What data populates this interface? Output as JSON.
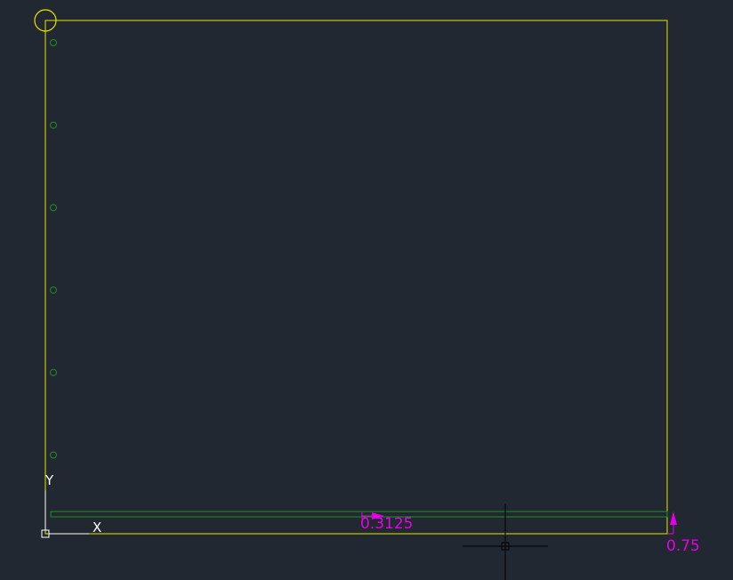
{
  "viewport": {
    "background": "#222831"
  },
  "colors": {
    "border": "#e6e600",
    "holes": "#1f8f1f",
    "strip": "#1f8f1f",
    "dimension": "#e600e6",
    "ucs": "#ffffff",
    "crosshair": "#000000"
  },
  "dimensions": {
    "horizontal_label": "0.3125",
    "vertical_label": "0.75"
  },
  "ucs_icon": {
    "x_label": "X",
    "y_label": "Y",
    "icon": "ucs-axis-icon"
  },
  "cursor": {
    "icon": "crosshair-cursor-icon"
  },
  "drawing": {
    "hole_count": 6
  }
}
